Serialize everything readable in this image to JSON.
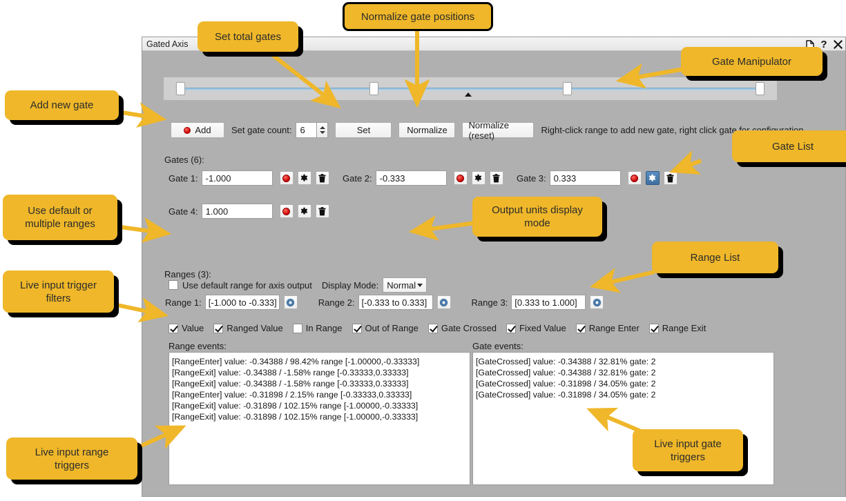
{
  "window": {
    "title": "Gated Axis",
    "titlebar_buttons": [
      {
        "name": "restore-icon",
        "glyph": "❐"
      },
      {
        "name": "help-icon",
        "glyph": "?"
      },
      {
        "name": "close-icon",
        "glyph": "✕"
      }
    ]
  },
  "manipulator": {
    "handles_percent": [
      0,
      33.3,
      66.6,
      100
    ],
    "value_marker_percent": 52.2
  },
  "toolbar": {
    "add_label": "Add",
    "gate_count_label": "Set gate count:",
    "gate_count_value": "6",
    "set_label": "Set",
    "normalize_label": "Normalize",
    "normalize_reset_label": "Normalize (reset)",
    "hint": "Right-click range to add new gate, right click gate for configuration"
  },
  "gates": {
    "header": "Gates (6):",
    "items": [
      {
        "label": "Gate 1:",
        "value": "-1.000",
        "gear_active": false
      },
      {
        "label": "Gate 2:",
        "value": "-0.333",
        "gear_active": false
      },
      {
        "label": "Gate 3:",
        "value": "0.333",
        "gear_active": true
      },
      {
        "label": "Gate 4:",
        "value": "1.000",
        "gear_active": false
      }
    ]
  },
  "options": {
    "default_range_label": "Use default range for axis output",
    "default_range_checked": false,
    "display_mode_label": "Display Mode:",
    "display_mode_value": "Normal"
  },
  "ranges": {
    "header": "Ranges (3):",
    "items": [
      {
        "label": "Range 1:",
        "value": "[-1.000 to -0.333]"
      },
      {
        "label": "Range 2:",
        "value": "[-0.333 to 0.333]"
      },
      {
        "label": "Range 3:",
        "value": "[0.333 to 1.000]"
      }
    ]
  },
  "filters": [
    {
      "label": "Value",
      "checked": true
    },
    {
      "label": "Ranged Value",
      "checked": true
    },
    {
      "label": "In Range",
      "checked": false
    },
    {
      "label": "Out of Range",
      "checked": true
    },
    {
      "label": "Gate Crossed",
      "checked": true
    },
    {
      "label": "Fixed Value",
      "checked": true
    },
    {
      "label": "Range Enter",
      "checked": true
    },
    {
      "label": "Range Exit",
      "checked": true
    }
  ],
  "range_events": {
    "label": "Range events:",
    "lines": [
      "[RangeEnter] value: -0.34388 / 98.42% range [-1.00000,-0.33333]",
      "[RangeExit] value: -0.34388 / -1.58% range [-0.33333,0.33333]",
      "[RangeExit] value: -0.34388 / -1.58% range [-0.33333,0.33333]",
      "[RangeEnter] value: -0.31898 / 2.15% range [-0.33333,0.33333]",
      "[RangeExit] value: -0.31898 / 102.15% range [-1.00000,-0.33333]",
      "[RangeExit] value: -0.31898 / 102.15% range [-1.00000,-0.33333]"
    ]
  },
  "gate_events": {
    "label": "Gate events:",
    "lines": [
      "[GateCrossed] value: -0.34388 / 32.81% gate: 2",
      "[GateCrossed] value: -0.34388 / 32.81% gate: 2",
      "[GateCrossed] value: -0.31898 / 34.05% gate: 2",
      "[GateCrossed] value: -0.31898 / 34.05% gate: 2"
    ]
  },
  "callouts": {
    "set_total_gates": "Set total gates",
    "normalize_gate_positions": "Normalize gate positions",
    "gate_manipulator": "Gate Manipulator",
    "add_new_gate": "Add new gate",
    "gate_list": "Gate List",
    "use_default_or_multiple_ranges": "Use default or\nmultiple ranges",
    "output_units_display_mode": "Output units display\nmode",
    "range_list": "Range List",
    "live_input_trigger_filters": "Live input trigger\nfilters",
    "live_input_range_triggers": "Live input range\ntriggers",
    "live_input_gate_triggers": "Live input gate\ntriggers"
  },
  "colors": {
    "callout_fill": "#efb729",
    "arrow": "#efb729",
    "window_bg": "#b0b0b0",
    "accent_active": "#3f6f9f"
  }
}
